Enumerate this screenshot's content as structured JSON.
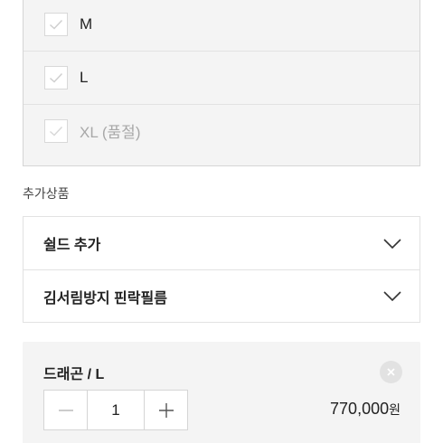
{
  "sizes": [
    {
      "label": "M",
      "sold_out": false
    },
    {
      "label": "L",
      "sold_out": false
    },
    {
      "label": "XL (품절)",
      "sold_out": true
    }
  ],
  "addons": {
    "title": "추가상품",
    "items": [
      {
        "label": "쉴드 추가",
        "icon": "chevron-down-icon"
      },
      {
        "label": "김서림방지 핀락필름",
        "icon": "chevron-down-icon"
      }
    ]
  },
  "selected": {
    "name": "드래곤 / L",
    "quantity": "1",
    "minus_icon": "minus-icon",
    "plus_icon": "plus-icon",
    "remove_icon": "close-icon",
    "price": "770,000",
    "currency": "원"
  },
  "colors": {
    "panel_bg": "#f4f4f4",
    "border": "#d5d5d5",
    "sold_out_text": "#a8a8a8",
    "check_mark": "#cfcfcf"
  }
}
